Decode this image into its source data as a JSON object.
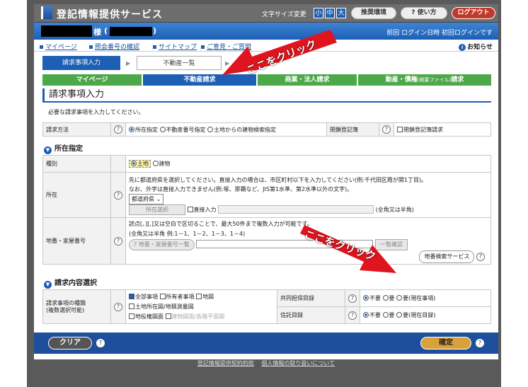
{
  "header": {
    "title": "登記情報提供サービス",
    "font_size_label": "文字サイズ変更",
    "font_sizes": [
      "小",
      "中",
      "大"
    ],
    "recommended_env": "推奨環境",
    "how_to_use": "使い方",
    "logout": "ログアウト"
  },
  "userbar": {
    "sama": "様",
    "paren_open": "(",
    "paren_close": ")",
    "last_login": "前回 ログイン日時 初回ログインです"
  },
  "links": {
    "mypage": "マイページ",
    "lot_number_check": "照会番号の確認",
    "sitemap": "サイトマップ",
    "feedback": "ご意見・ご質問",
    "notice": "お知らせ"
  },
  "steps": {
    "current": "請求事項入力",
    "next": "不動産一覧"
  },
  "tabs": {
    "mypage": "マイページ",
    "real_estate": "不動産請求",
    "corporate": "商業・法人請求",
    "movable_prefix": "動産・債権",
    "movable_small": "(概要ファイル)",
    "movable_suffix": "請求"
  },
  "page_title": "請求事項入力",
  "instruction": "必要な請求事項を入力してください。",
  "request_method": {
    "label": "請求方法",
    "options": [
      "所在指定",
      "不動産番号指定",
      "土地からの建物検索指定"
    ],
    "closed_registry_label": "閉鎖登記簿",
    "closed_registry_option": "閉鎖登記簿請求"
  },
  "section_location": {
    "title": "所在指定",
    "type_label": "種別",
    "type_options": [
      "土地",
      "建物"
    ],
    "location_label": "所在",
    "location_help1": "先に都道府県を選択してください。直接入力の場合は、市区町村以下を入力してください(例:千代田区霞が関1丁目)。",
    "location_help2": "なお、外字は直接入力できません(例:塚、那覇など、JIS第1水準、第2水準以外の文字)。",
    "prefecture_select": "都道府県",
    "location_select_btn": "所在選択",
    "direct_input": "直接入力",
    "width_note": "(全角又は半角)",
    "lot_label": "地番・家屋番号",
    "lot_help1": "読点[、][,]又は空白で区切ることで、最大50件まで複数入力が可能です。",
    "lot_help2": "(全角又は半角 例:1－1、1－2、1－3、1－4)",
    "lot_list_btn": "地番・家屋番号一覧",
    "list_confirm_btn": "一覧確認",
    "lot_search_btn": "地番検索サービス"
  },
  "section_content": {
    "title": "請求内容選択",
    "kind_label": "請求事項の種類",
    "kind_label2": "(複数選択可能)",
    "kinds": [
      "全部事項",
      "所有者事項",
      "地図",
      "土地所在図/地積測量図",
      "地役権図面",
      "建物図面/各階平面図"
    ],
    "joint_label": "共同担保目録",
    "joint_options": [
      "不要",
      "要",
      "要(現在事項)"
    ],
    "trust_label": "信託目録",
    "trust_options": [
      "不要",
      "要",
      "要(現在目録)"
    ]
  },
  "footer": {
    "clear": "クリア",
    "confirm": "確定",
    "terms": "登記情報提供契約約款",
    "privacy": "個人情報の取り扱いについて"
  },
  "callouts": {
    "top": "ここをクリック",
    "bottom": "ここをクリック"
  },
  "colors": {
    "brand_blue": "#1d5fb4",
    "tab_green": "#4da84a",
    "callout_red": "#e0141e",
    "confirm_gold": "#d9a13a"
  }
}
